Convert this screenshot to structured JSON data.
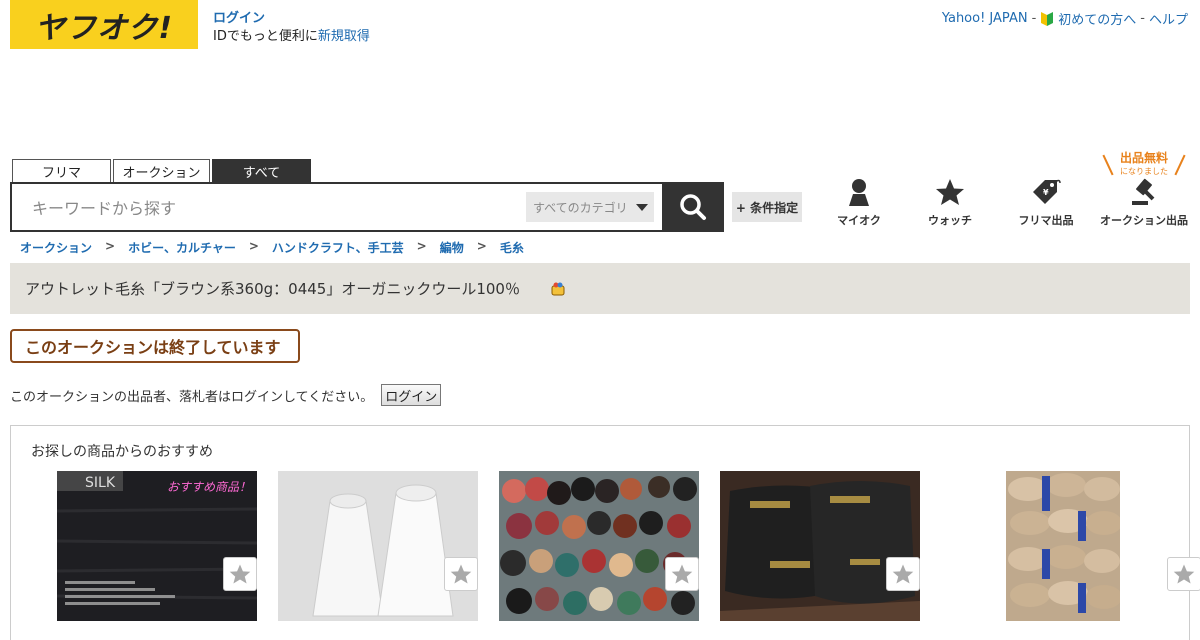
{
  "header": {
    "logo_text": "ヤフオク!",
    "login_label": "ログイン",
    "login_sub_prefix": "IDでもっと便利に",
    "register_label": "新規取得",
    "links": {
      "yahoo_japan": "Yahoo! JAPAN",
      "beginners": "初めての方へ",
      "help": "ヘルプ"
    }
  },
  "search": {
    "tabs": [
      "フリマ",
      "オークション",
      "すべて"
    ],
    "placeholder": "キーワードから探す",
    "category": "すべてのカテゴリ",
    "condition_button": "+ 条件指定"
  },
  "nav": {
    "myauction": "マイオク",
    "watch": "ウォッチ",
    "flea_listing": "フリマ出品",
    "auction_listing": "オークション出品",
    "free_badge": "出品無料",
    "free_badge_sub": "になりました"
  },
  "breadcrumb": [
    "オークション",
    "ホビー、カルチャー",
    "ハンドクラフト、手工芸",
    "編物",
    "毛糸"
  ],
  "breadcrumb_separator": ">",
  "title": "アウトレット毛糸「ブラウン系360g：0445」オーガニックウール100％",
  "ended_banner": "このオークションは終了しています",
  "login_note": "このオークションの出品者、落札者はログインしてください。",
  "login_button": "ログイン",
  "recommend": {
    "title": "お探しの商品からのおすすめ",
    "thumb1_brand": "SILK",
    "thumb1_badge": "おすすめ商品！"
  },
  "colors": {
    "logo_bg": "#f9d01e",
    "link": "#1f6bb0",
    "ended_border": "#8a4a1c",
    "badge": "#e8821c"
  }
}
